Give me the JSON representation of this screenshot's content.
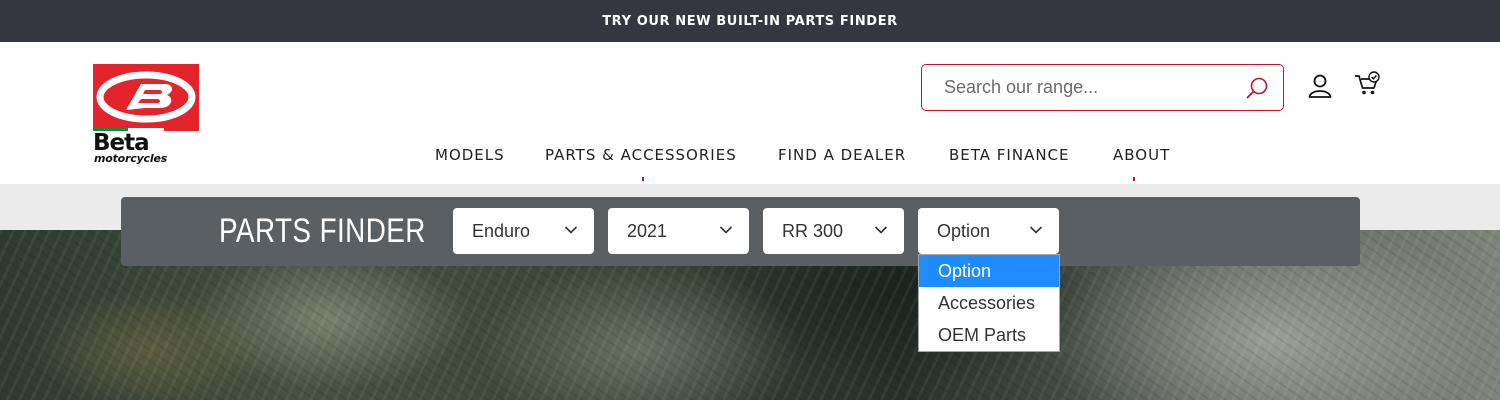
{
  "announcement": {
    "text": "TRY OUR NEW BUILT-IN PARTS FINDER"
  },
  "brand": {
    "name": "Beta",
    "tagline": "motorcycles",
    "color": "#e3242b"
  },
  "search": {
    "placeholder": "Search our range...",
    "value": ""
  },
  "header_icons": [
    "account-icon",
    "cart-icon"
  ],
  "nav": {
    "items": [
      {
        "label": "MODELS"
      },
      {
        "label": "PARTS & ACCESSORIES"
      },
      {
        "label": "FIND A DEALER"
      },
      {
        "label": "BETA FINANCE"
      },
      {
        "label": "ABOUT"
      }
    ]
  },
  "parts_finder": {
    "title": "PARTS FINDER",
    "selects": [
      {
        "value": "Enduro"
      },
      {
        "value": "2021"
      },
      {
        "value": "RR 300"
      },
      {
        "value": "Option"
      }
    ],
    "dropdown": {
      "options": [
        "Option",
        "Accessories",
        "OEM Parts"
      ],
      "highlighted": "Option",
      "highlight_color": "#1e8bff"
    }
  },
  "colors": {
    "accent": "#c8102e",
    "topbar": "#363640",
    "finder_bg": "#5a5f64"
  }
}
